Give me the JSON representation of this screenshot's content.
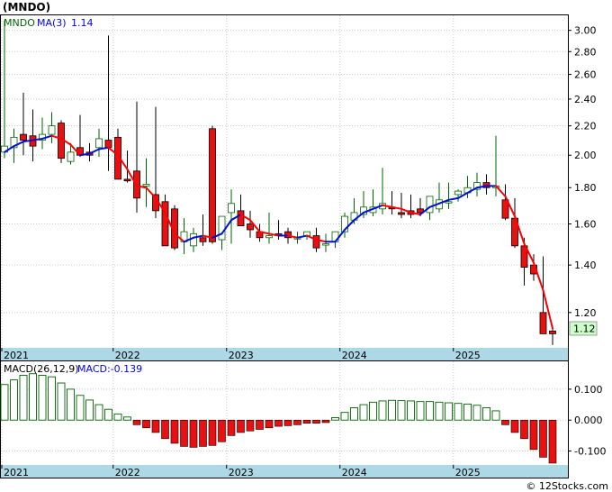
{
  "title": "(MNDO)",
  "price_panel": {
    "legend_symbol": "MNDO",
    "legend_ma": "MA(3)",
    "legend_ma_value": "1.14",
    "last_price_label": "1.12",
    "y_ticks": [
      "3.00",
      "2.80",
      "2.60",
      "2.40",
      "2.20",
      "2.00",
      "1.80",
      "1.60",
      "1.40",
      "1.20"
    ]
  },
  "macd_panel": {
    "legend_macd": "MACD(26,12,9)",
    "legend_value": "MACD:-0.139",
    "y_ticks": [
      "0.100",
      "0.000",
      "-0.100"
    ]
  },
  "x_years": [
    "2021",
    "2022",
    "2023",
    "2024",
    "2025"
  ],
  "watermark": "© 12Stocks.com",
  "colors": {
    "up_candle": "#ffffff",
    "up_outline": "#006400",
    "down_candle": "#e81010",
    "ma_rising": "#0010d0",
    "ma_falling": "#ff0000",
    "macd_pos_fill": "#ffffff",
    "macd_pos_outline": "#006400",
    "macd_neg": "#e81010",
    "axis_band": "#add8e6",
    "last_price_box": "#ccffcc"
  },
  "chart_data": [
    {
      "type": "candlestick",
      "title": "(MNDO)",
      "y_scale": "log",
      "ylim": [
        1.07,
        3.15
      ],
      "x": [
        "2021-01",
        "2021-02",
        "2021-03",
        "2021-04",
        "2021-05",
        "2021-06",
        "2021-07",
        "2021-08",
        "2021-09",
        "2021-10",
        "2021-11",
        "2021-12",
        "2022-01",
        "2022-02",
        "2022-03",
        "2022-04",
        "2022-05",
        "2022-06",
        "2022-07",
        "2022-08",
        "2022-09",
        "2022-10",
        "2022-11",
        "2022-12",
        "2023-01",
        "2023-02",
        "2023-03",
        "2023-04",
        "2023-05",
        "2023-06",
        "2023-07",
        "2023-08",
        "2023-09",
        "2023-10",
        "2023-11",
        "2023-12",
        "2024-01",
        "2024-02",
        "2024-03",
        "2024-04",
        "2024-05",
        "2024-06",
        "2024-07",
        "2024-08",
        "2024-09",
        "2024-10",
        "2024-11",
        "2024-12",
        "2025-01",
        "2025-02",
        "2025-03",
        "2025-04",
        "2025-05",
        "2025-06",
        "2025-07",
        "2025-08",
        "2025-09",
        "2025-10",
        "2025-11"
      ],
      "open": [
        2.02,
        2.05,
        2.14,
        2.13,
        2.1,
        2.14,
        2.22,
        1.96,
        2.05,
        2.02,
        2.05,
        2.1,
        2.12,
        1.85,
        1.9,
        1.81,
        1.76,
        1.72,
        1.68,
        1.51,
        1.49,
        1.53,
        2.18,
        1.52,
        1.66,
        1.67,
        1.6,
        1.56,
        1.53,
        1.55,
        1.56,
        1.53,
        1.54,
        1.54,
        1.5,
        1.51,
        1.56,
        1.62,
        1.65,
        1.66,
        1.68,
        1.69,
        1.66,
        1.67,
        1.68,
        1.66,
        1.68,
        1.72,
        1.76,
        1.77,
        1.79,
        1.83,
        1.8,
        1.73,
        1.63,
        1.49,
        1.4,
        1.2,
        1.13
      ],
      "high": [
        3.1,
        2.18,
        2.45,
        2.32,
        2.26,
        2.3,
        2.24,
        2.08,
        2.28,
        2.08,
        2.18,
        2.95,
        2.18,
        2.03,
        2.38,
        1.98,
        2.34,
        1.76,
        1.7,
        1.63,
        1.58,
        1.65,
        2.2,
        1.62,
        1.79,
        1.76,
        1.67,
        1.6,
        1.66,
        1.62,
        1.58,
        1.56,
        1.56,
        1.58,
        1.55,
        1.56,
        1.66,
        1.74,
        1.78,
        1.79,
        1.92,
        1.78,
        1.77,
        1.76,
        1.74,
        1.75,
        1.83,
        1.83,
        1.79,
        1.87,
        1.89,
        1.88,
        2.13,
        1.82,
        1.74,
        1.53,
        1.45,
        1.44,
        1.15
      ],
      "low": [
        1.98,
        1.95,
        2.0,
        1.96,
        2.04,
        2.08,
        1.95,
        1.94,
        1.99,
        1.96,
        1.99,
        1.9,
        1.87,
        1.83,
        1.66,
        1.69,
        1.63,
        1.57,
        1.47,
        1.45,
        1.46,
        1.49,
        1.5,
        1.47,
        1.5,
        1.62,
        1.53,
        1.51,
        1.5,
        1.52,
        1.5,
        1.5,
        1.52,
        1.46,
        1.46,
        1.48,
        1.53,
        1.6,
        1.63,
        1.64,
        1.65,
        1.65,
        1.63,
        1.63,
        1.64,
        1.62,
        1.66,
        1.68,
        1.72,
        1.74,
        1.75,
        1.76,
        1.75,
        1.62,
        1.48,
        1.31,
        1.33,
        1.2,
        1.08
      ],
      "close": [
        2.06,
        2.12,
        2.1,
        2.06,
        2.14,
        2.2,
        1.98,
        2.02,
        2.0,
        2.0,
        2.11,
        2.05,
        1.85,
        1.84,
        1.74,
        1.82,
        1.67,
        1.49,
        1.48,
        1.56,
        1.55,
        1.51,
        1.51,
        1.64,
        1.71,
        1.59,
        1.57,
        1.53,
        1.54,
        1.54,
        1.53,
        1.53,
        1.56,
        1.48,
        1.5,
        1.56,
        1.64,
        1.66,
        1.69,
        1.69,
        1.71,
        1.68,
        1.65,
        1.65,
        1.66,
        1.75,
        1.73,
        1.72,
        1.78,
        1.8,
        1.83,
        1.8,
        1.81,
        1.63,
        1.49,
        1.39,
        1.36,
        1.12,
        1.12
      ],
      "ma3": [
        2.02,
        2.06,
        2.09,
        2.1,
        2.11,
        2.13,
        2.11,
        2.07,
        2.0,
        2.01,
        2.04,
        2.05,
        2.0,
        1.91,
        1.81,
        1.8,
        1.74,
        1.66,
        1.55,
        1.51,
        1.53,
        1.54,
        1.53,
        1.55,
        1.62,
        1.65,
        1.62,
        1.56,
        1.55,
        1.54,
        1.54,
        1.53,
        1.54,
        1.52,
        1.51,
        1.51,
        1.57,
        1.62,
        1.66,
        1.68,
        1.7,
        1.69,
        1.68,
        1.66,
        1.65,
        1.69,
        1.71,
        1.73,
        1.74,
        1.77,
        1.8,
        1.81,
        1.81,
        1.75,
        1.64,
        1.5,
        1.41,
        1.29,
        1.14
      ]
    },
    {
      "type": "bar",
      "title": "MACD(26,12,9)",
      "ylim": [
        -0.145,
        0.19
      ],
      "x": [
        "2021-01",
        "2021-02",
        "2021-03",
        "2021-04",
        "2021-05",
        "2021-06",
        "2021-07",
        "2021-08",
        "2021-09",
        "2021-10",
        "2021-11",
        "2021-12",
        "2022-01",
        "2022-02",
        "2022-03",
        "2022-04",
        "2022-05",
        "2022-06",
        "2022-07",
        "2022-08",
        "2022-09",
        "2022-10",
        "2022-11",
        "2022-12",
        "2023-01",
        "2023-02",
        "2023-03",
        "2023-04",
        "2023-05",
        "2023-06",
        "2023-07",
        "2023-08",
        "2023-09",
        "2023-10",
        "2023-11",
        "2023-12",
        "2024-01",
        "2024-02",
        "2024-03",
        "2024-04",
        "2024-05",
        "2024-06",
        "2024-07",
        "2024-08",
        "2024-09",
        "2024-10",
        "2024-11",
        "2024-12",
        "2025-01",
        "2025-02",
        "2025-03",
        "2025-04",
        "2025-05",
        "2025-06",
        "2025-07",
        "2025-08",
        "2025-09",
        "2025-10",
        "2025-11"
      ],
      "values": [
        0.115,
        0.13,
        0.145,
        0.15,
        0.145,
        0.14,
        0.12,
        0.1,
        0.08,
        0.065,
        0.05,
        0.035,
        0.02,
        0.01,
        -0.015,
        -0.025,
        -0.04,
        -0.06,
        -0.075,
        -0.085,
        -0.088,
        -0.085,
        -0.082,
        -0.07,
        -0.05,
        -0.04,
        -0.035,
        -0.03,
        -0.025,
        -0.02,
        -0.018,
        -0.015,
        -0.01,
        -0.01,
        -0.008,
        0.008,
        0.025,
        0.04,
        0.05,
        0.058,
        0.062,
        0.064,
        0.063,
        0.062,
        0.06,
        0.06,
        0.058,
        0.056,
        0.054,
        0.052,
        0.048,
        0.04,
        0.03,
        -0.015,
        -0.04,
        -0.06,
        -0.095,
        -0.12,
        -0.139
      ]
    }
  ]
}
